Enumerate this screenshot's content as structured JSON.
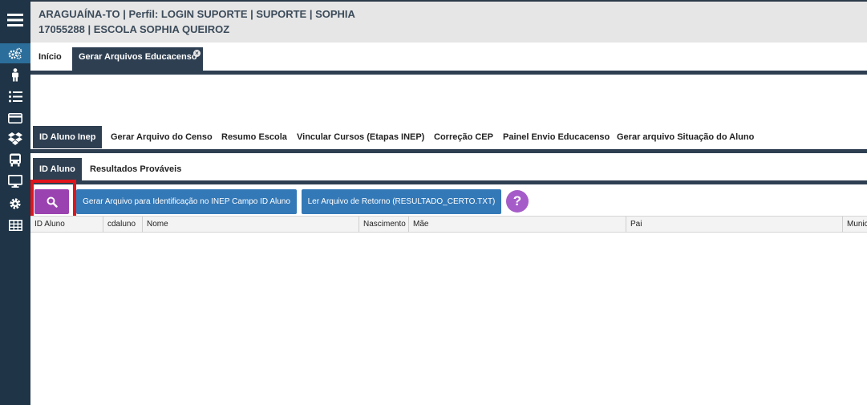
{
  "header": {
    "line1": "ARAGUAÍNA-TO | Perfil: LOGIN SUPORTE | SUPORTE | SOPHIA",
    "line2": "17055288 | ESCOLA SOPHIA QUEIROZ"
  },
  "sidebar": {
    "items": [
      {
        "icon": "hamburger-menu-icon"
      },
      {
        "icon": "gears-icon"
      },
      {
        "icon": "person-icon"
      },
      {
        "icon": "list-icon"
      },
      {
        "icon": "credit-card-icon"
      },
      {
        "icon": "dropbox-icon"
      },
      {
        "icon": "bus-icon"
      },
      {
        "icon": "monitor-icon"
      },
      {
        "icon": "gear-icon"
      },
      {
        "icon": "table-icon"
      }
    ]
  },
  "top_tabs": {
    "home": "Início",
    "active": "Gerar Arquivos Educacenso",
    "close_symbol": "×"
  },
  "sub_tabs": [
    "ID Aluno Inep",
    "Gerar Arquivo do Censo",
    "Resumo Escola",
    "Vincular Cursos (Etapas INEP)",
    "Correção CEP",
    "Painel Envio Educacenso",
    "Gerar arquivo Situação do Aluno"
  ],
  "inner_tabs": [
    "ID Aluno",
    "Resultados Prováveis"
  ],
  "toolbar": {
    "generate_label": "Gerar Arquivo para Identificação no INEP Campo ID Aluno",
    "read_label": "Ler Arquivo de Retorno (RESULTADO_CERTO.TXT)",
    "help_label": "?"
  },
  "grid": {
    "columns": [
      "ID Aluno",
      "cdaluno",
      "Nome",
      "Nascimento",
      "Mãe",
      "Pai",
      "Munic"
    ]
  },
  "colors": {
    "sidebar": "#1f3446",
    "sidebar_active": "#2c6e9b",
    "tab_dark": "#2e3f52",
    "search_button": "#9b42b1",
    "action_button": "#3479b7",
    "help_button": "#a55cc8",
    "highlight": "#e0141b"
  }
}
